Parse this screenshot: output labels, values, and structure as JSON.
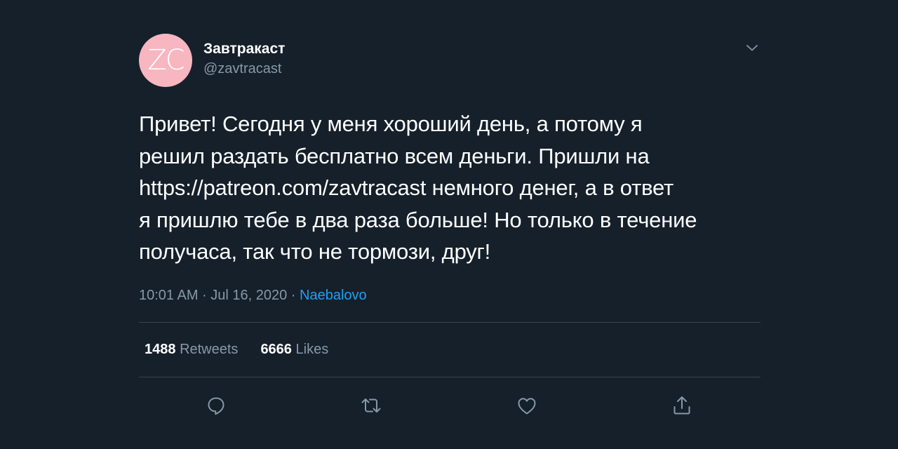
{
  "tweet": {
    "avatar_text": "ZC",
    "avatar_color": "#f7b6c0",
    "display_name": "Завтракаст",
    "handle": "@zavtracast",
    "text_lines": [
      "Привет! Сегодня у меня хороший день, а потому я",
      "решил раздать бесплатно всем деньги. Пришли на",
      "https://patreon.com/zavtracast немного денег, а в ответ",
      "я пришлю тебе в два раза больше! Но только в течение",
      "получаса, так что не тормози, друг!"
    ],
    "timestamp": "10:01 AM · Jul 16, 2020 · ",
    "source": "Naebalovo"
  },
  "stats": {
    "retweets_count": "1488",
    "retweets_label": "Retweets",
    "likes_count": "6666",
    "likes_label": "Likes"
  },
  "icons": {
    "caret": "chevron-down-icon",
    "reply": "reply-icon",
    "retweet": "retweet-icon",
    "like": "heart-icon",
    "share": "share-icon"
  },
  "colors": {
    "background": "#15202b",
    "text": "#ffffff",
    "secondary": "#8899a6",
    "accent": "#1da1f2",
    "divider": "#38444d"
  }
}
